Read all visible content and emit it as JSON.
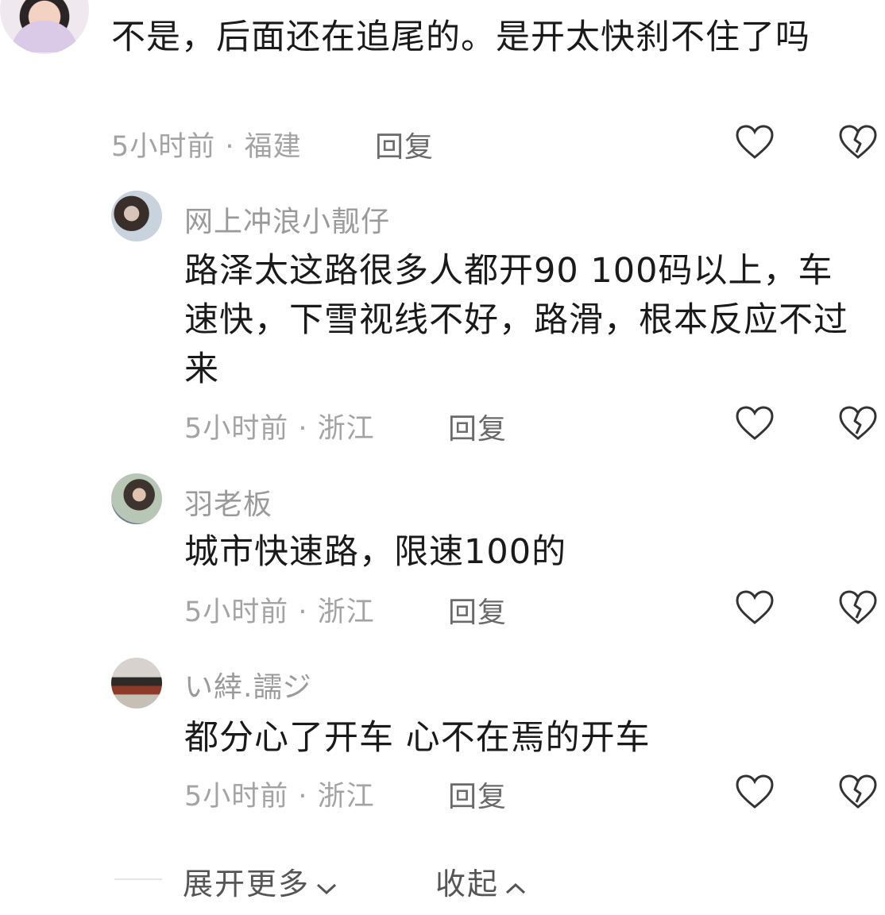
{
  "comments": [
    {
      "content": "不是，后面还在追尾的。是开太快刹不住了吗",
      "meta": "5小时前 · 福建",
      "reply_label": "回复"
    }
  ],
  "replies": [
    {
      "username": "网上冲浪小靓仔",
      "content": "路泽太这路很多人都开90 100码以上，车速快，下雪视线不好，路滑，根本反应不过来",
      "meta": "5小时前 · 浙江",
      "reply_label": "回复"
    },
    {
      "username": "羽老板",
      "content": "城市快速路，限速100的",
      "meta": "5小时前 · 浙江",
      "reply_label": "回复"
    },
    {
      "username": "い緈.譳ジ",
      "content": "都分心了开车  心不在焉的开车",
      "meta": "5小时前 · 浙江",
      "reply_label": "回复"
    }
  ],
  "footer": {
    "expand_more": "展开更多",
    "collapse": "收起"
  },
  "icons": {
    "like": "heart-outline-icon",
    "dislike": "broken-heart-outline-icon",
    "expand": "chevron-down-icon",
    "collapse": "chevron-up-icon"
  },
  "colors": {
    "text": "#1a1a1a",
    "meta": "#a3a3a3",
    "username": "#9a9a9a"
  }
}
